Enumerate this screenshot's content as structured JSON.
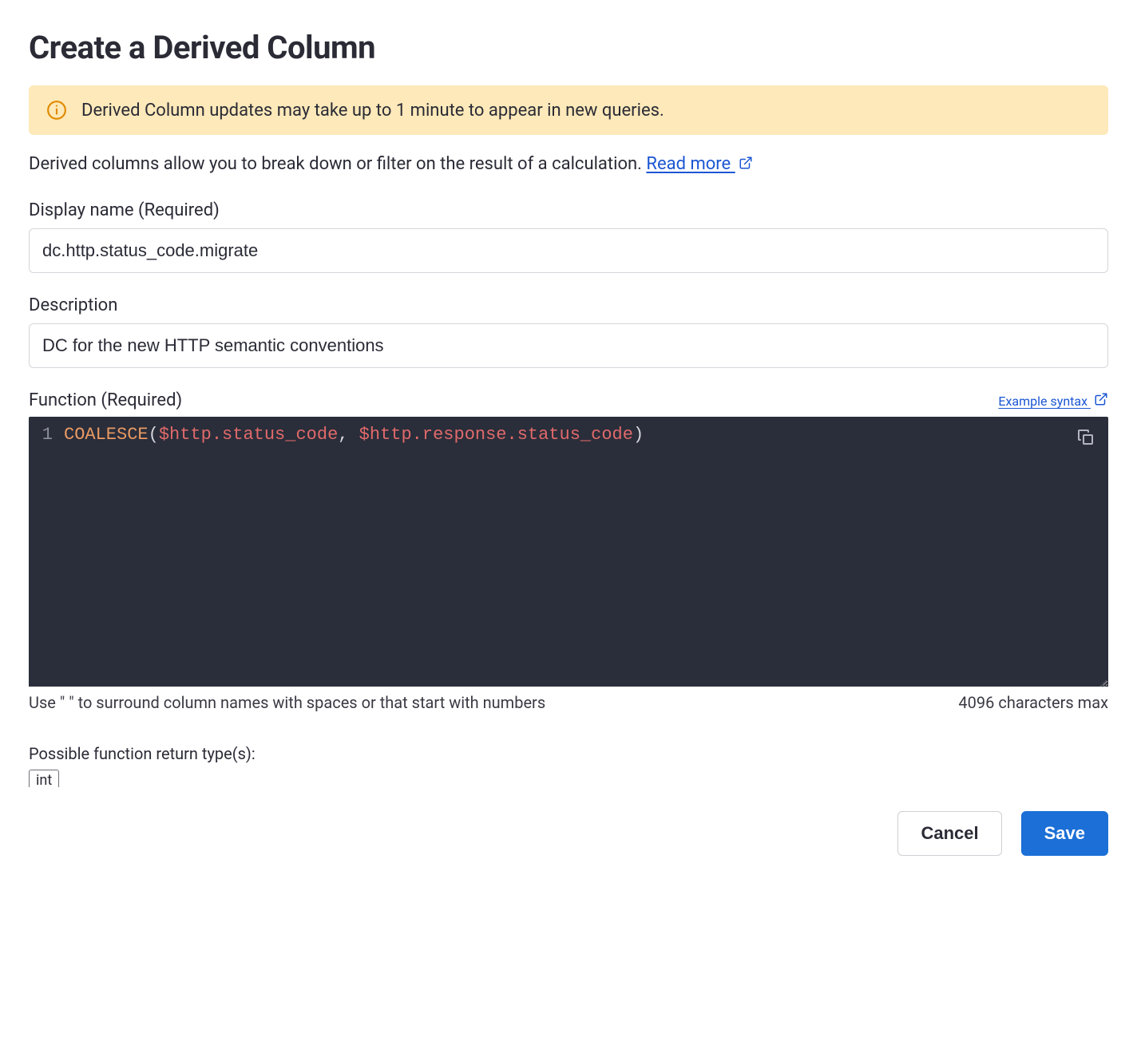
{
  "page": {
    "title": "Create a Derived Column"
  },
  "banner": {
    "message": "Derived Column updates may take up to 1 minute to appear in new queries."
  },
  "intro": {
    "text": "Derived columns allow you to break down or filter on the result of a calculation. ",
    "link_label": "Read more"
  },
  "fields": {
    "display_name": {
      "label": "Display name (Required)",
      "value": "dc.http.status_code.migrate"
    },
    "description": {
      "label": "Description",
      "value": "DC for the new HTTP semantic conventions"
    },
    "function": {
      "label": "Function (Required)",
      "example_link_label": "Example syntax",
      "code": {
        "line_number": "1",
        "tokens": {
          "fn": "COALESCE",
          "lp": "(",
          "var1": "$http.status_code",
          "comma": ", ",
          "var2": "$http.response.status_code",
          "rp": ")"
        }
      },
      "hint_left": "Use \" \" to surround column names with spaces or that start with numbers",
      "hint_right": "4096 characters max"
    }
  },
  "return_types": {
    "label": "Possible function return type(s):",
    "types": [
      "int"
    ]
  },
  "footer": {
    "cancel_label": "Cancel",
    "save_label": "Save"
  }
}
